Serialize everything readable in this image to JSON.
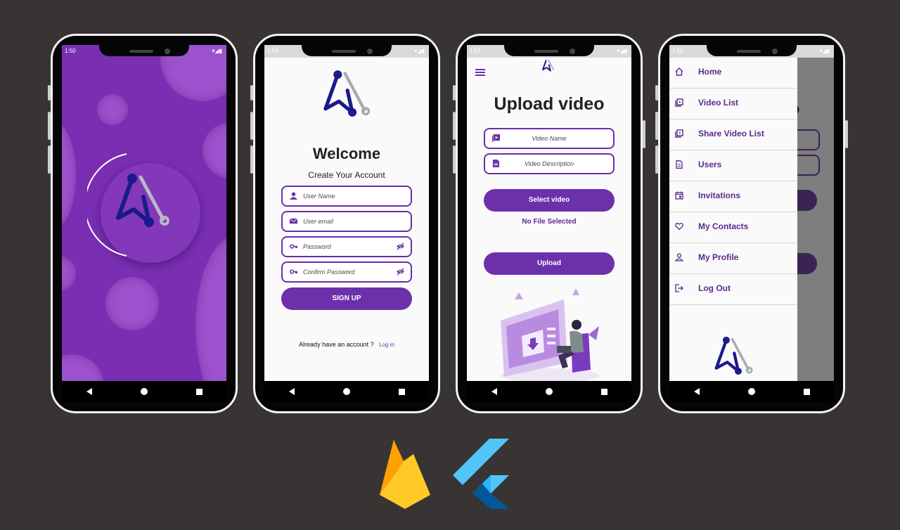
{
  "status_times": [
    "1:50",
    "1:59",
    "1:57",
    "1:58"
  ],
  "signup": {
    "title": "Welcome",
    "subtitle": "Create Your Account",
    "fields": [
      "User Name",
      "User email",
      "Password",
      "Confirm Password"
    ],
    "button": "SIGN UP",
    "footer_text": "Already have an account ?",
    "login_link": "Log in"
  },
  "upload": {
    "title": "Upload video",
    "fields": [
      "Video Name",
      "Video Description"
    ],
    "select_button": "Select video",
    "no_file": "No File Selected",
    "upload_button": "Upload"
  },
  "drawer": {
    "items": [
      {
        "label": "Home",
        "icon": "home-icon"
      },
      {
        "label": "Video List",
        "icon": "video-list-icon"
      },
      {
        "label": "Share Video List",
        "icon": "share-video-icon"
      },
      {
        "label": "Users",
        "icon": "document-icon"
      },
      {
        "label": "Invitations",
        "icon": "calendar-icon"
      },
      {
        "label": "My Contacts",
        "icon": "heart-icon"
      },
      {
        "label": "My Profile",
        "icon": "person-icon"
      },
      {
        "label": "Log Out",
        "icon": "logout-icon"
      }
    ],
    "behind_title_fragment": "o"
  },
  "colors": {
    "background": "#383433",
    "primary": "#6c31aa",
    "splash": "#7a2fb3",
    "logo_blue": "#1a1a8c",
    "logo_gray": "#a9a9b5"
  }
}
